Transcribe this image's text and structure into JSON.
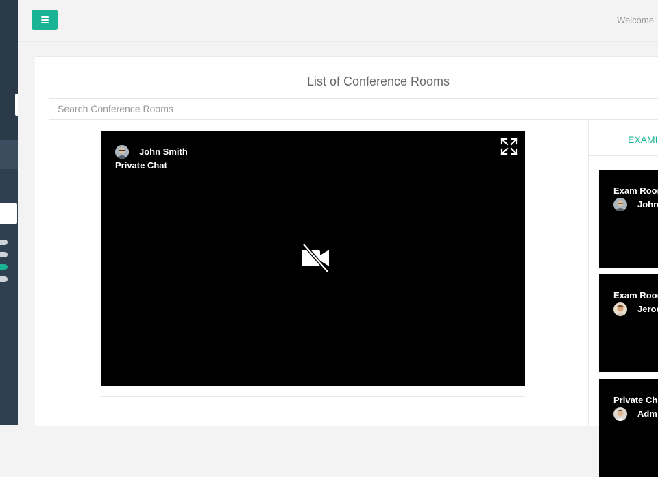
{
  "header": {
    "welcome_text": "Welcome"
  },
  "page": {
    "title": "List of Conference Rooms",
    "search_placeholder": "Search Conference Rooms"
  },
  "main_video": {
    "participant_name": "John Smith",
    "room_name": "Private Chat",
    "icons": [
      "avatar",
      "expand-icon",
      "camera-off-icon"
    ]
  },
  "tabs": {
    "exam_label": "EXAMI"
  },
  "room_cards": [
    {
      "title": "Exam Roor",
      "participant": "John"
    },
    {
      "title": "Exam Roor",
      "participant": "Jeroe"
    },
    {
      "title": "Private Ch",
      "participant": "Adm"
    }
  ],
  "colors": {
    "accent": "#1ab394",
    "sidebar": "#2f4050",
    "video_bg": "#000000"
  }
}
